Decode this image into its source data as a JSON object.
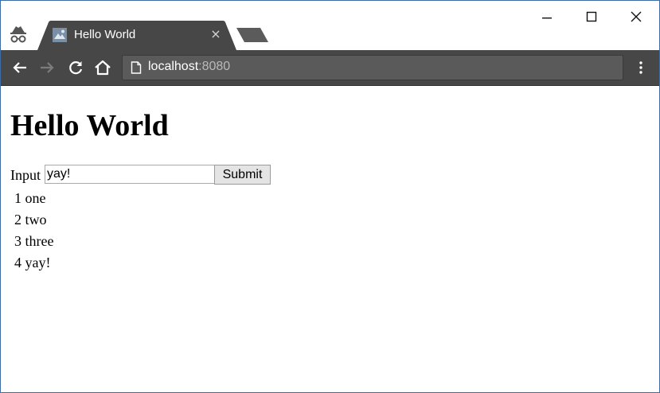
{
  "browser": {
    "tab": {
      "title": "Hello World",
      "close_glyph": "×"
    },
    "address_bar": {
      "host": "localhost",
      "port": ":8080"
    },
    "icons": {
      "incognito": "incognito-icon",
      "favicon": "page-favicon-icon",
      "back": "back-arrow-icon",
      "forward": "forward-arrow-icon",
      "reload": "reload-icon",
      "home": "home-icon",
      "page": "page-info-icon",
      "menu": "kebab-menu-icon"
    },
    "colors": {
      "toolbar": "#474747",
      "tab": "#474747",
      "omnibox": "#5a5a5a",
      "frame_border": "#3c6ea5"
    }
  },
  "page": {
    "heading": "Hello World",
    "form": {
      "label": "Input",
      "input_value": "yay!",
      "submit_label": "Submit"
    },
    "items": [
      {
        "id": "1",
        "text": "one"
      },
      {
        "id": "2",
        "text": "two"
      },
      {
        "id": "3",
        "text": "three"
      },
      {
        "id": "4",
        "text": "yay!"
      }
    ]
  }
}
